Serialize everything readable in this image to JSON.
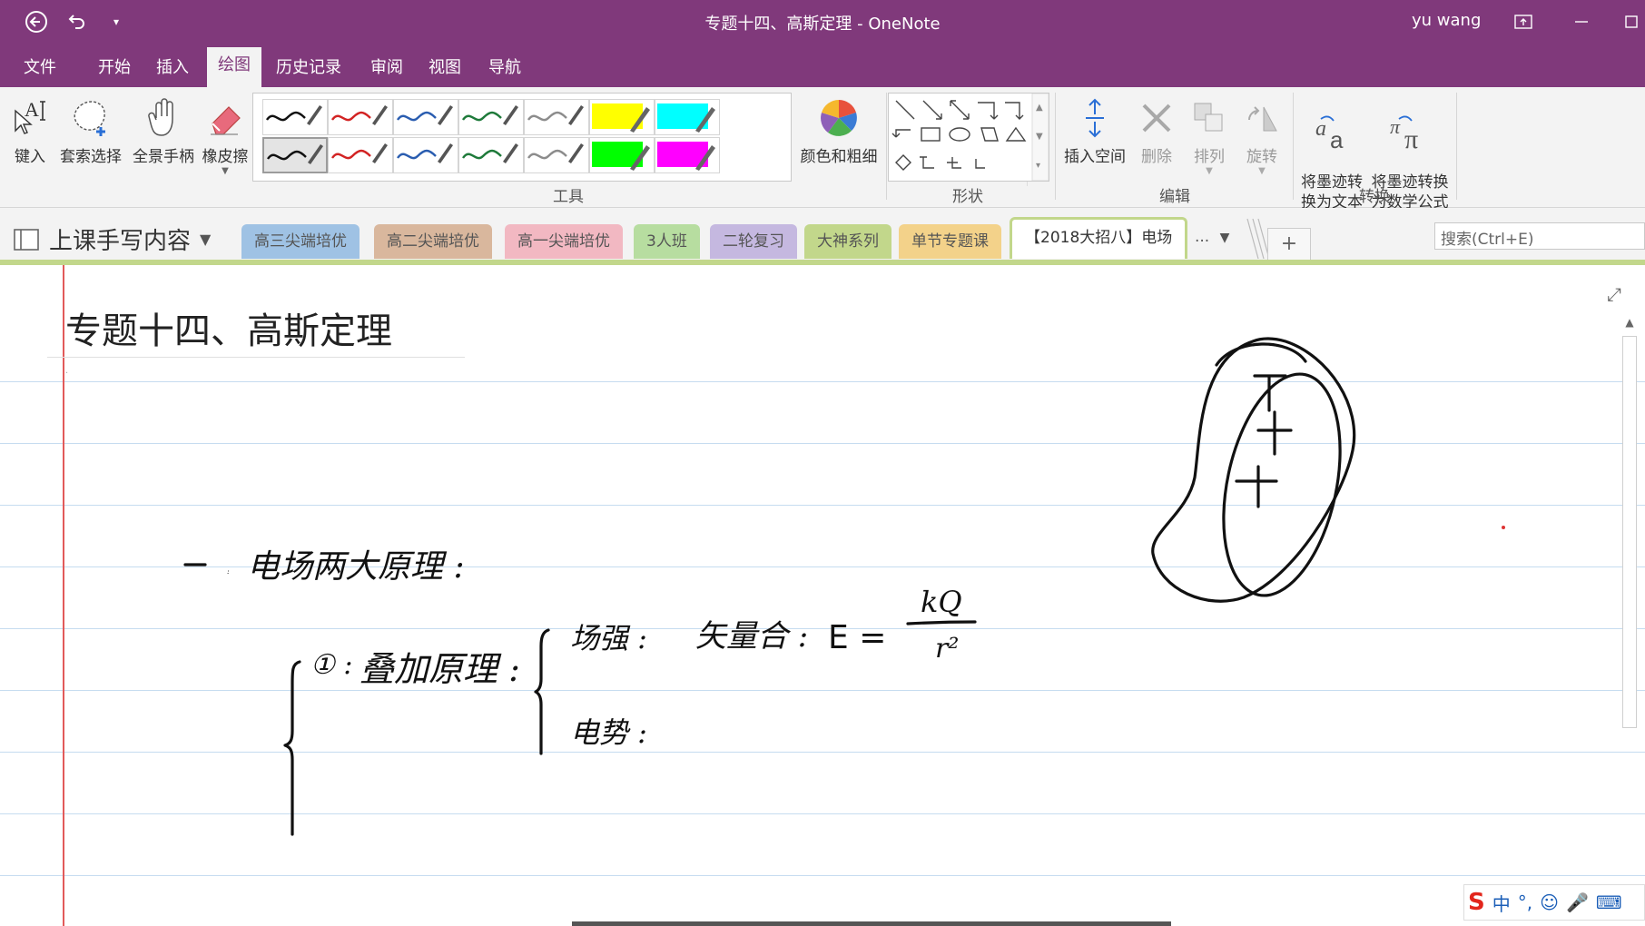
{
  "window": {
    "title": "专题十四、高斯定理  -  OneNote",
    "user": "yu wang"
  },
  "menu": {
    "tabs": [
      "文件",
      "开始",
      "插入",
      "绘图",
      "历史记录",
      "审阅",
      "视图",
      "导航"
    ],
    "active": "绘图"
  },
  "ribbon": {
    "tools": {
      "type_label": "键入",
      "lasso_label": "套索选择",
      "pan_label": "全景手柄",
      "eraser_label": "橡皮擦",
      "group_label": "工具",
      "pens": [
        {
          "color": "#111111",
          "kind": "pen"
        },
        {
          "color": "#d22323",
          "kind": "pen"
        },
        {
          "color": "#2a5db0",
          "kind": "pen"
        },
        {
          "color": "#1e7a3a",
          "kind": "pen"
        },
        {
          "color": "#8c8c8c",
          "kind": "pen"
        },
        {
          "color": "#ffff00",
          "kind": "highlighter"
        },
        {
          "color": "#00ffff",
          "kind": "highlighter"
        },
        {
          "color": "#111111",
          "kind": "pen"
        },
        {
          "color": "#d22323",
          "kind": "pen"
        },
        {
          "color": "#2a5db0",
          "kind": "pen"
        },
        {
          "color": "#1e7a3a",
          "kind": "pen"
        },
        {
          "color": "#8c8c8c",
          "kind": "pen"
        },
        {
          "color": "#00ff00",
          "kind": "highlighter"
        },
        {
          "color": "#ff00ff",
          "kind": "highlighter"
        }
      ],
      "color_thickness_label": "颜色和粗细"
    },
    "shapes": {
      "group_label": "形状"
    },
    "edit": {
      "insert_space_label": "插入空间",
      "delete_label": "删除",
      "arrange_label": "排列",
      "rotate_label": "旋转",
      "group_label": "编辑"
    },
    "convert": {
      "ink_to_text_label": "将墨迹转\n换为文本",
      "ink_to_math_label": "将墨迹转换\n为数学公式",
      "group_label": "转换"
    }
  },
  "notebook": {
    "name": "上课手写内容",
    "sections": [
      {
        "label": "高三尖端培优",
        "color": "#9fc2e4"
      },
      {
        "label": "高二尖端培优",
        "color": "#d9b79d"
      },
      {
        "label": "高一尖端培优",
        "color": "#f2b8c2"
      },
      {
        "label": "3人班",
        "color": "#b7dda0"
      },
      {
        "label": "二轮复习",
        "color": "#c5b8e0"
      },
      {
        "label": "大神系列",
        "color": "#c2d78b"
      },
      {
        "label": "单节专题课",
        "color": "#f3d28a"
      },
      {
        "label": "【2018大招八】电场",
        "color": "#ffffff"
      }
    ],
    "more_label": "...",
    "add_label": "+",
    "search_placeholder": "搜索(Ctrl+E)"
  },
  "page": {
    "title": "专题十四、高斯定理",
    "ink_text": {
      "heading": "一：电场两大原理：",
      "item1": "①：叠加原理：",
      "field": "场强：",
      "vector_sum": "矢量合：",
      "formula_lhs": "E =",
      "numerator": "kQ",
      "denominator": "r²",
      "potential": "电势："
    }
  },
  "ime": {
    "mode_label": "中",
    "punct_label": "°,"
  }
}
